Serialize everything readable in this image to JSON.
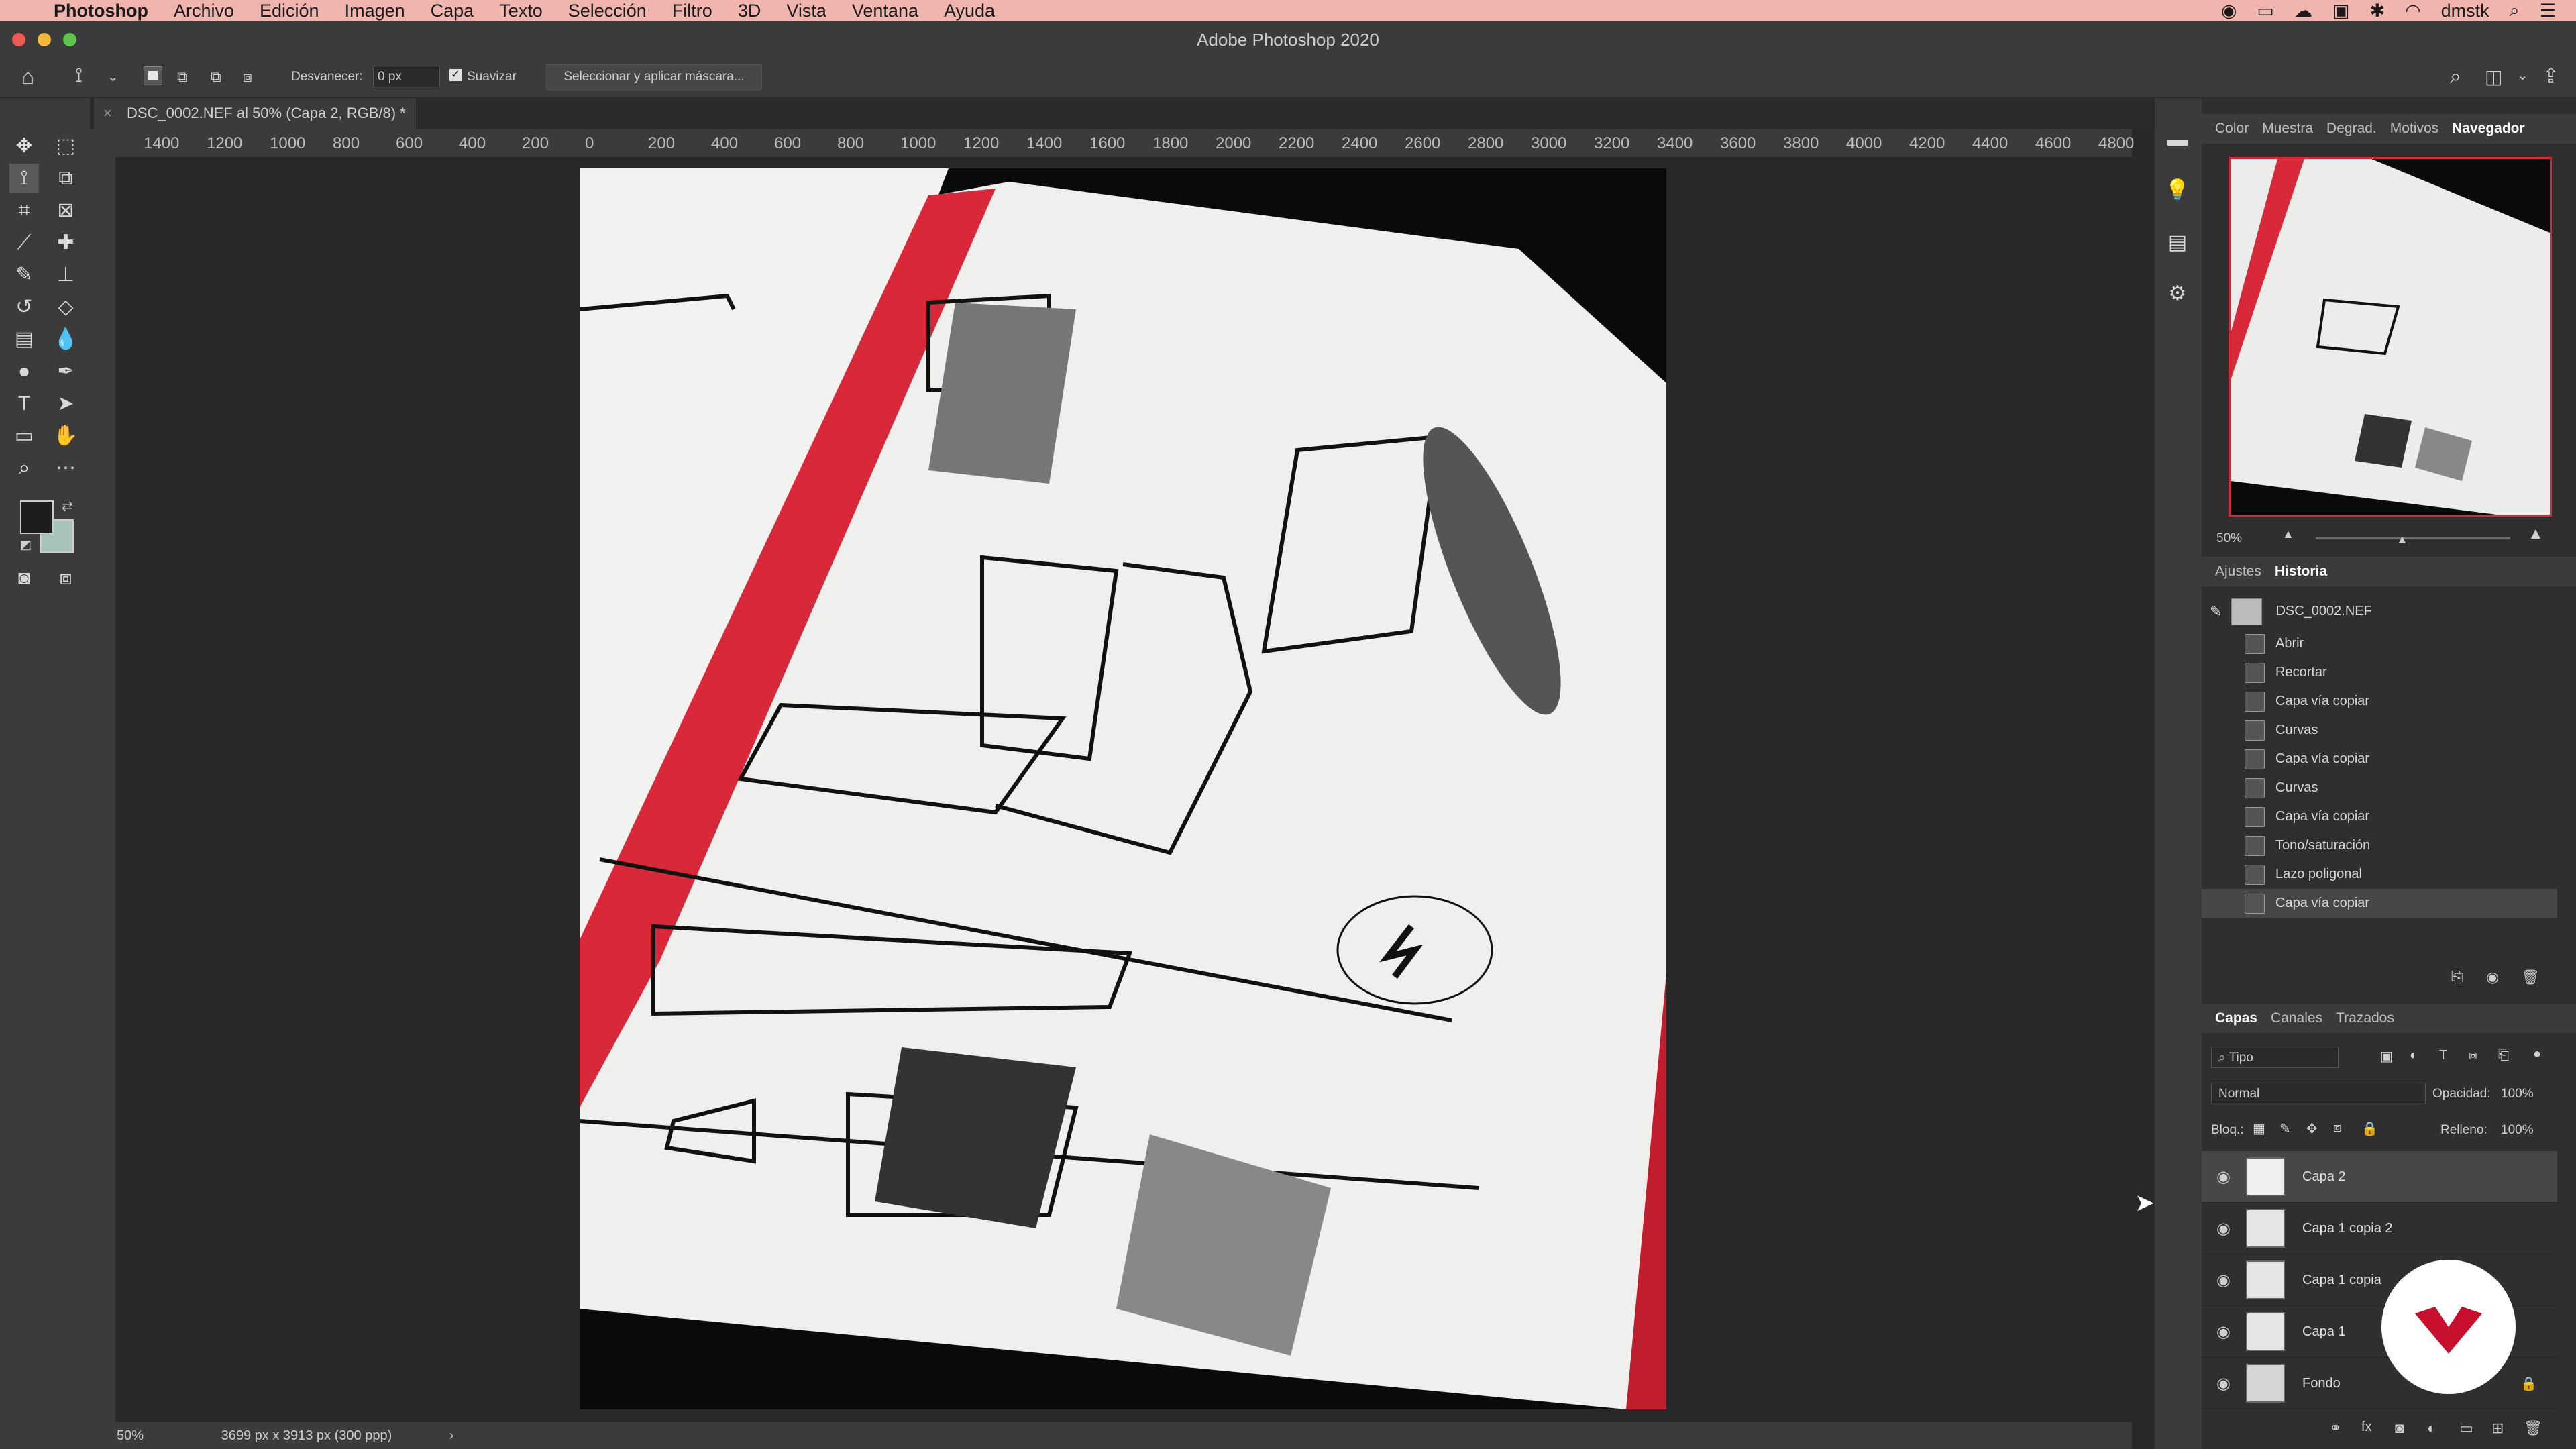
{
  "menubar": {
    "app_name": "Photoshop",
    "items": [
      "Archivo",
      "Edición",
      "Imagen",
      "Capa",
      "Texto",
      "Selección",
      "Filtro",
      "3D",
      "Vista",
      "Ventana",
      "Ayuda"
    ],
    "user": "dmstk"
  },
  "window": {
    "title": "Adobe Photoshop 2020"
  },
  "options": {
    "feather_label": "Desvanecer:",
    "feather_value": "0 px",
    "antialias_label": "Suavizar",
    "select_mask_label": "Seleccionar y aplicar máscara..."
  },
  "document": {
    "tab_title": "DSC_0002.NEF al 50% (Capa 2, RGB/8) *",
    "zoom": "50%",
    "size_info": "3699 px x 3913 px (300 ppp)"
  },
  "ruler_h": [
    "1400",
    "1200",
    "1000",
    "800",
    "600",
    "400",
    "200",
    "0",
    "200",
    "400",
    "600",
    "800",
    "1000",
    "1200",
    "1400",
    "1600",
    "1800",
    "2000",
    "2200",
    "2400",
    "2600",
    "2800",
    "3000",
    "3200",
    "3400",
    "3600",
    "3800",
    "4000",
    "4200",
    "4400",
    "4600",
    "4800"
  ],
  "panels": {
    "top_tabs": [
      "Color",
      "Muestra",
      "Degrad.",
      "Motivos",
      "Navegador"
    ],
    "navigator_zoom": "50%",
    "mid_tabs": [
      "Ajustes",
      "Historia"
    ],
    "history_source": "DSC_0002.NEF",
    "history": [
      "Abrir",
      "Recortar",
      "Capa vía copiar",
      "Curvas",
      "Capa vía copiar",
      "Curvas",
      "Capa vía copiar",
      "Tono/saturación",
      "Lazo poligonal",
      "Capa vía copiar"
    ],
    "bottom_tabs": [
      "Capas",
      "Canales",
      "Trazados"
    ],
    "filter_placeholder": "Tipo",
    "blend_mode": "Normal",
    "opacity_label": "Opacidad:",
    "opacity_value": "100%",
    "lock_label": "Bloq.:",
    "fill_label": "Relleno:",
    "fill_value": "100%",
    "layers": [
      "Capa 2",
      "Capa 1 copia 2",
      "Capa 1 copia",
      "Capa 1",
      "Fondo"
    ]
  },
  "colors": {
    "accent_red": "#d9283a",
    "menubar_bg": "#f1b5b0",
    "selected_row": "#474747"
  }
}
